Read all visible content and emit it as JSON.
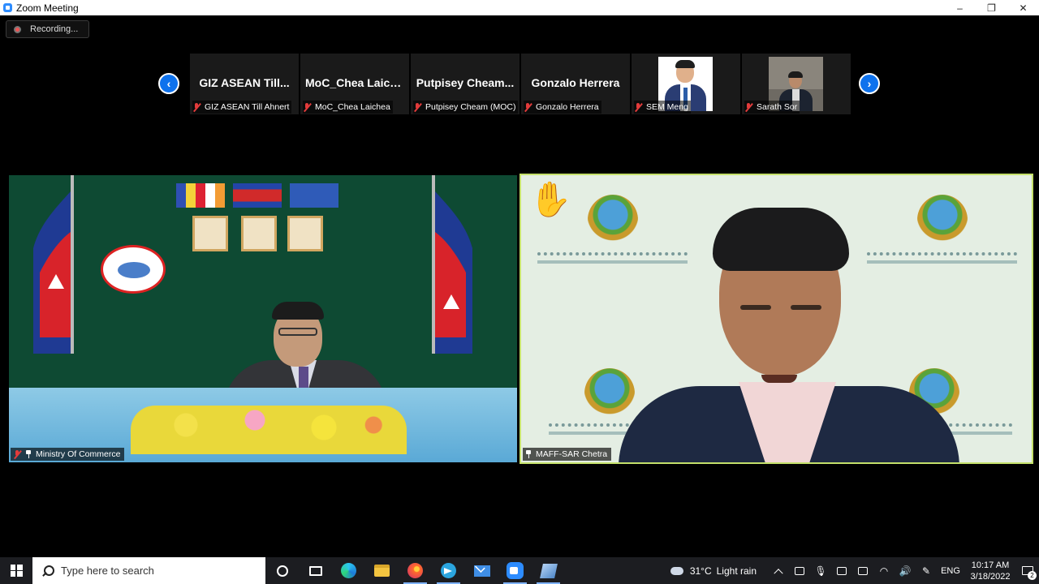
{
  "window": {
    "title": "Zoom Meeting",
    "minimize": "–",
    "restore": "❐",
    "close": "✕"
  },
  "recording": {
    "label": "Recording..."
  },
  "gallery": {
    "prev_icon": "chevron-left-icon",
    "next_icon": "chevron-right-icon",
    "prev_glyph": "‹",
    "next_glyph": "›",
    "participants": [
      {
        "display": "GIZ ASEAN Till...",
        "label": "GIZ ASEAN Till Ahnert",
        "muted": true,
        "has_video": false
      },
      {
        "display": "MoC_Chea Laich...",
        "label": "MoC_Chea Laichea",
        "muted": true,
        "has_video": false
      },
      {
        "display": "Putpisey Cheam...",
        "label": "Putpisey Cheam (MOC)",
        "muted": true,
        "has_video": false
      },
      {
        "display": "Gonzalo Herrera",
        "label": "Gonzalo Herrera",
        "muted": true,
        "has_video": false
      },
      {
        "display": "",
        "label": "SEM Meng",
        "muted": true,
        "has_video": true
      },
      {
        "display": "",
        "label": "Sarath Sor",
        "muted": true,
        "has_video": true
      }
    ]
  },
  "videos": {
    "left": {
      "name": "Ministry Of Commerce",
      "muted": true,
      "pinned": true
    },
    "right": {
      "name": "MAFF-SAR Chetra",
      "pinned": true,
      "active_speaker": true,
      "hand_raised": true
    }
  },
  "taskbar": {
    "search_placeholder": "Type here to search",
    "apps": [
      "cortana-icon",
      "task-view-icon",
      "edge-icon",
      "file-explorer-icon",
      "firefox-icon",
      "telegram-icon",
      "mail-icon",
      "zoom-icon",
      "app-icon"
    ],
    "weather": {
      "temp": "31°C",
      "condition": "Light rain"
    },
    "language": "ENG",
    "time": "10:17 AM",
    "date": "3/18/2022",
    "notification_count": "2"
  },
  "colors": {
    "accent": "#0e72ed",
    "active_speaker_border": "#c4e06a",
    "muted_icon": "#e23b3b"
  }
}
